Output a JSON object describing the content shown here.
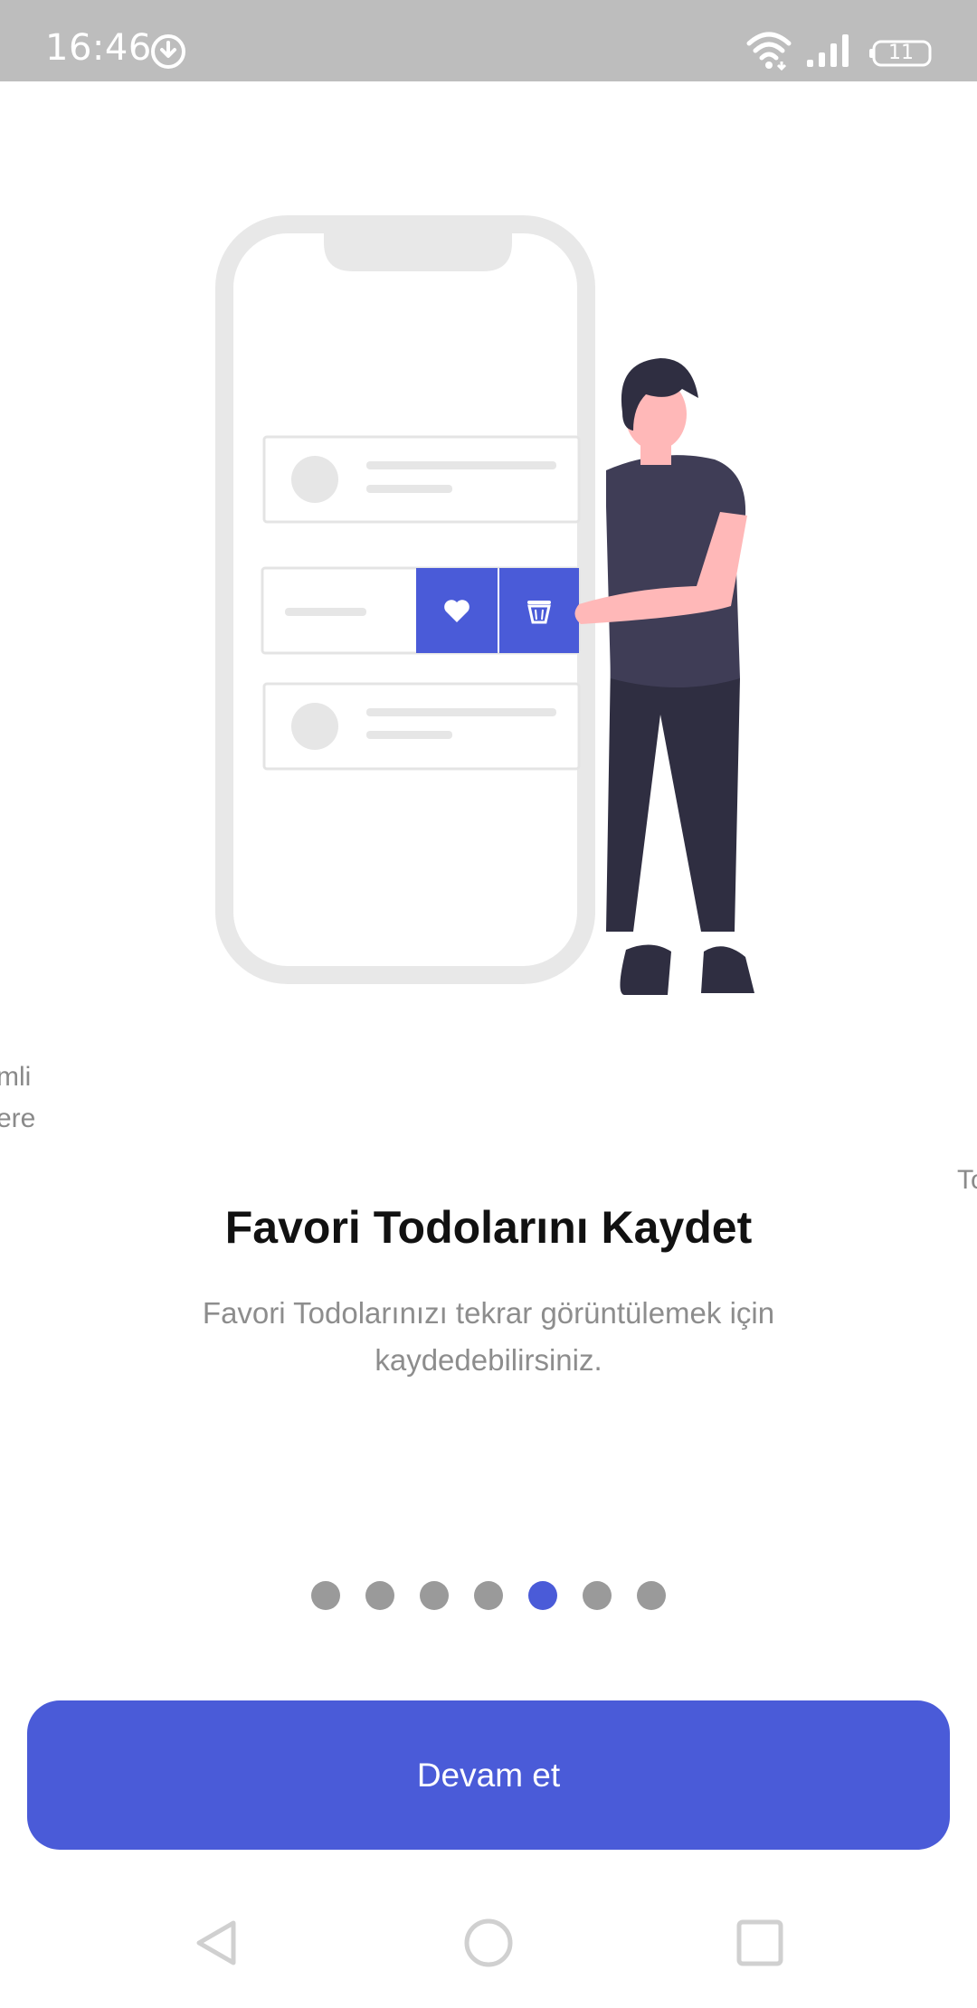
{
  "status_bar": {
    "time": "16:46",
    "battery": "11",
    "icons": [
      "download-icon",
      "wifi-icon",
      "signal-icon",
      "battery-icon"
    ]
  },
  "onboarding": {
    "title": "Favori Todolarını Kaydet",
    "description": "Favori Todolarınızı tekrar görüntülemek için kaydedebilirsiniz.",
    "prev_slide_peek": "mli\nere",
    "next_slide_peek": "To",
    "page_count": 7,
    "current_page": 5,
    "continue_label": "Devam et"
  },
  "colors": {
    "accent": "#4a5bd8",
    "dot_inactive": "#9a9a9a",
    "status_bar": "#bdbdbd"
  },
  "nav_bar": {
    "icons": [
      "back-icon",
      "home-icon",
      "recent-apps-icon"
    ]
  }
}
